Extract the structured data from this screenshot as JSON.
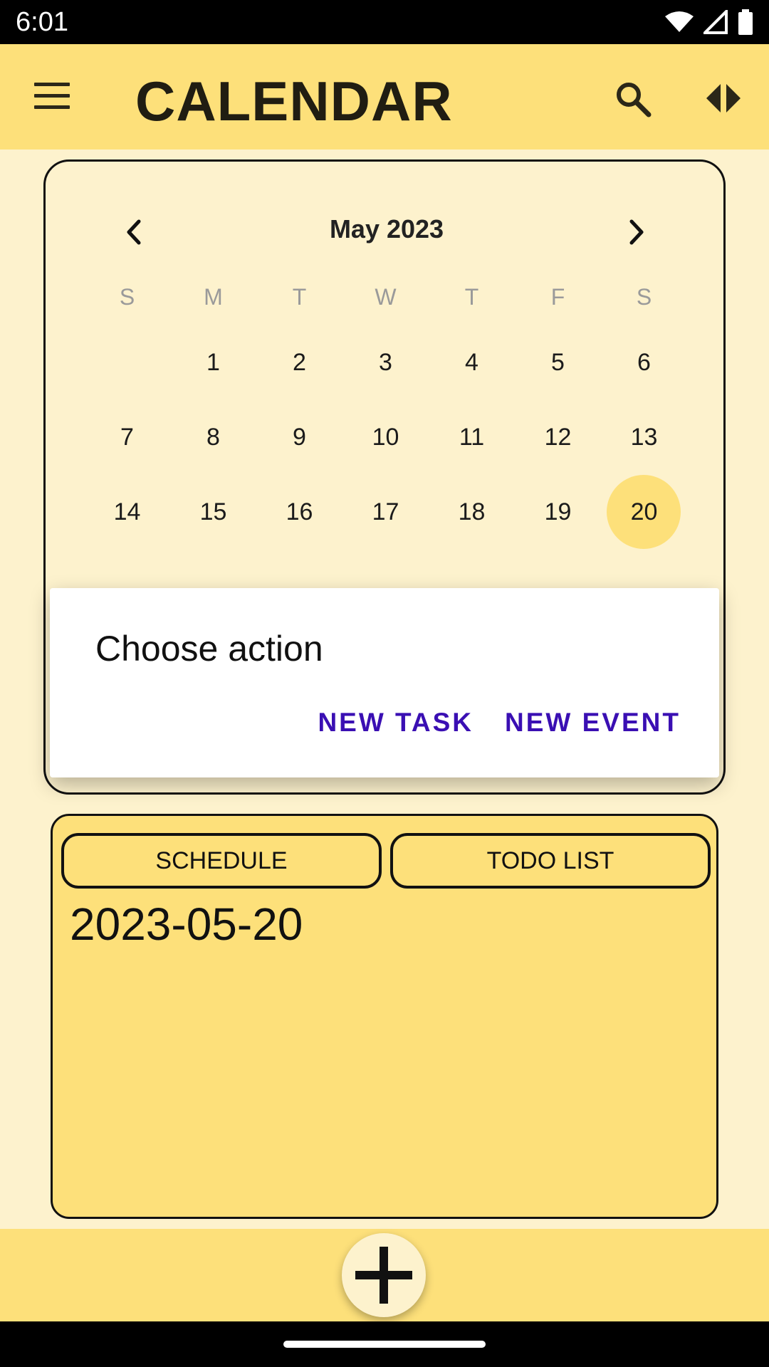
{
  "status_bar": {
    "time": "6:01"
  },
  "app_bar": {
    "title": "CALENDAR"
  },
  "calendar": {
    "month_label": "May 2023",
    "weekdays": [
      "S",
      "M",
      "T",
      "W",
      "T",
      "F",
      "S"
    ],
    "weeks": [
      [
        "",
        "1",
        "2",
        "3",
        "4",
        "5",
        "6"
      ],
      [
        "7",
        "8",
        "9",
        "10",
        "11",
        "12",
        "13"
      ],
      [
        "14",
        "15",
        "16",
        "17",
        "18",
        "19",
        "20"
      ]
    ],
    "selected_day": "20",
    "selected_color": "#fde07a"
  },
  "dialog": {
    "title": "Choose action",
    "new_task": "NEW TASK",
    "new_event": "NEW EVENT"
  },
  "list_panel": {
    "schedule_tab": "SCHEDULE",
    "todo_tab": "TODO LIST",
    "date": "2023-05-20"
  },
  "colors": {
    "accent": "#fde07a",
    "background": "#fdf2cd",
    "dialog_action": "#3a0fb3"
  }
}
